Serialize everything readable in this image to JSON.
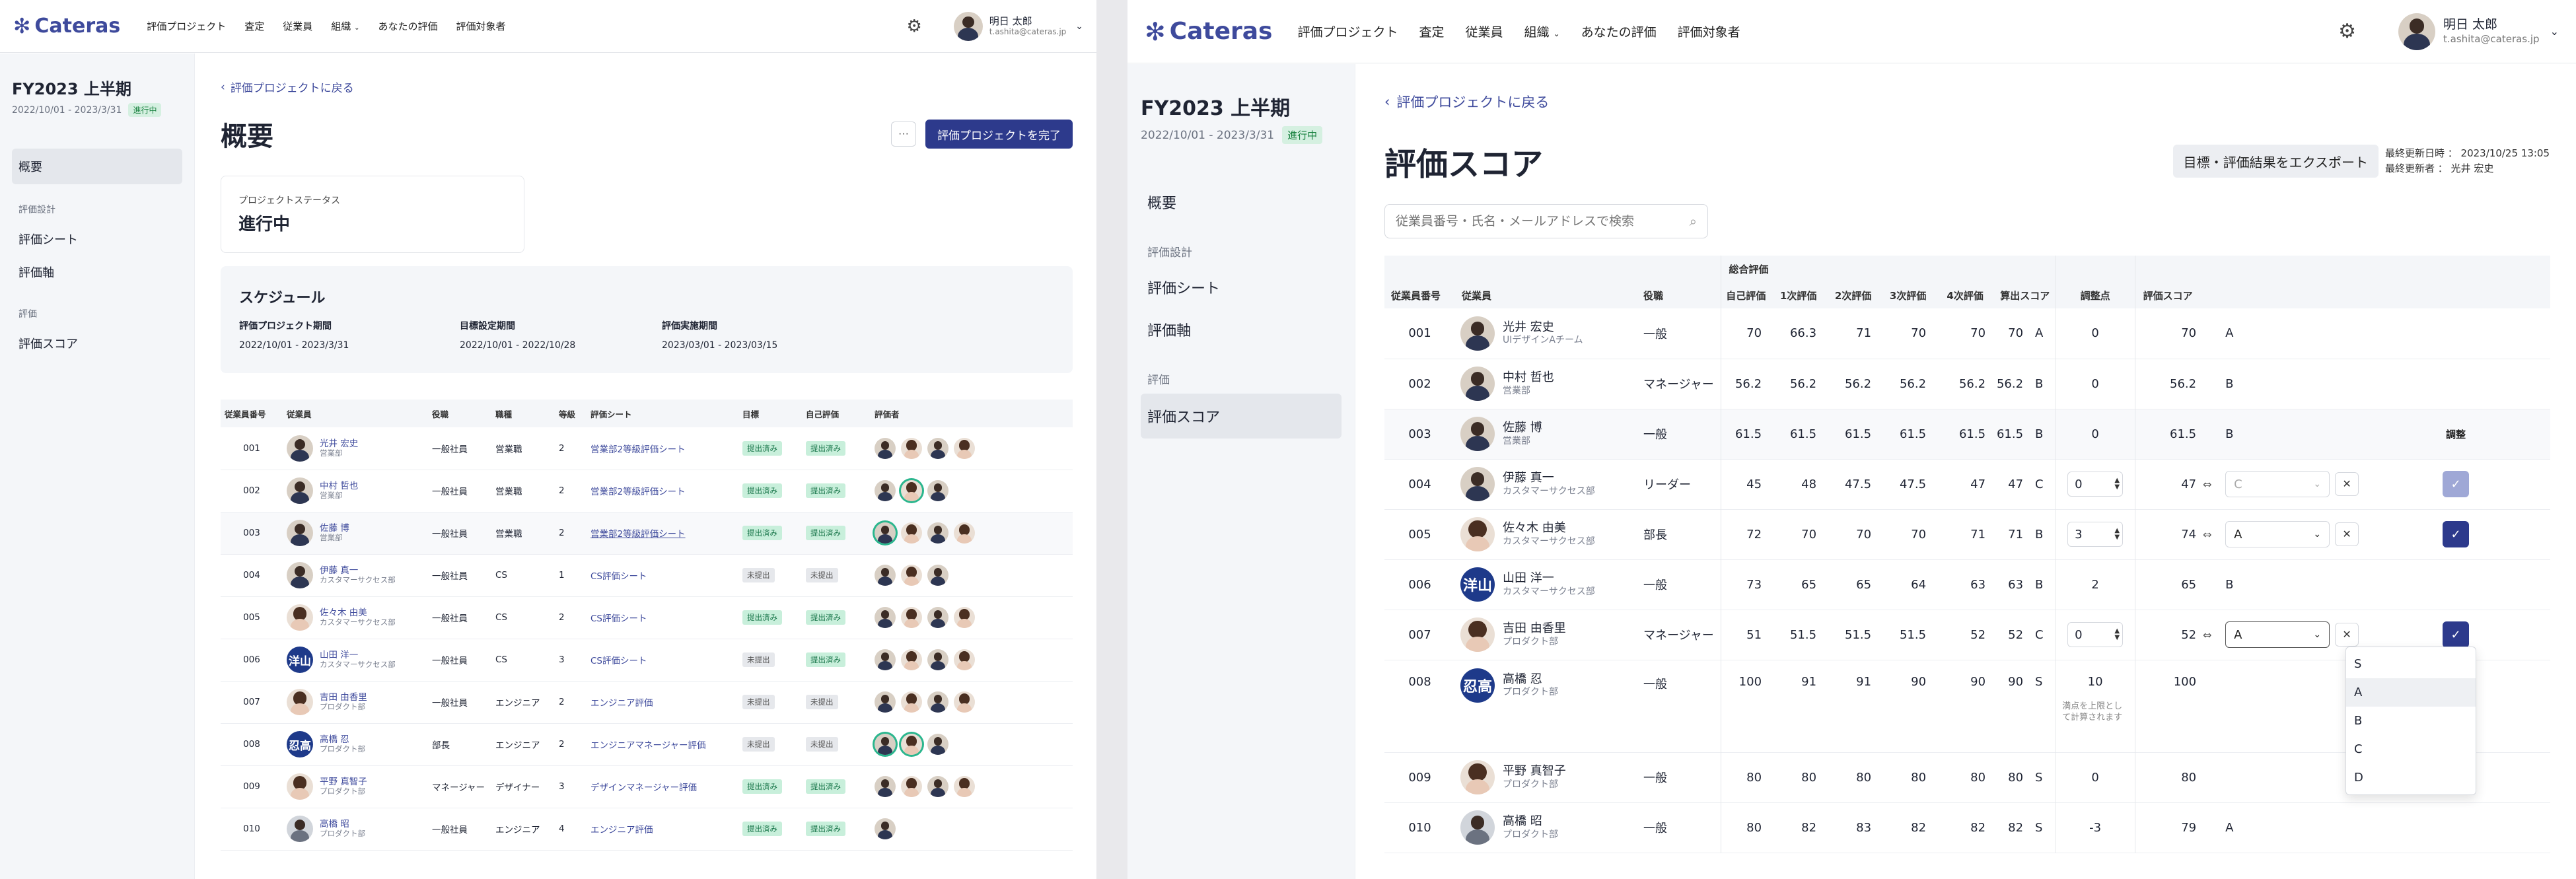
{
  "brand": {
    "name": "Cateras"
  },
  "nav": {
    "items": [
      "評価プロジェクト",
      "査定",
      "従業員",
      "組織",
      "あなたの評価",
      "評価対象者"
    ],
    "org_item": "組織"
  },
  "user": {
    "name": "明日 太郎",
    "email": "t.ashita@cateras.jp"
  },
  "project": {
    "name": "FY2023 上半期",
    "period": "2022/10/01 - 2023/3/31",
    "status": "進行中"
  },
  "sidebar": {
    "overview": "概要",
    "group_design": "評価設計",
    "sheet": "評価シート",
    "axis": "評価軸",
    "group_eval": "評価",
    "score": "評価スコア"
  },
  "back_link": "評価プロジェクトに戻る",
  "screenA": {
    "title": "概要",
    "more_button": "···",
    "complete_button": "評価プロジェクトを完了",
    "status_card": {
      "label": "プロジェクトステータス",
      "value": "進行中"
    },
    "schedule": {
      "title": "スケジュール",
      "items": [
        {
          "label": "評価プロジェクト期間",
          "value": "2022/10/01 - 2023/3/31"
        },
        {
          "label": "目標設定期間",
          "value": "2022/10/01 - 2022/10/28"
        },
        {
          "label": "評価実施期間",
          "value": "2023/03/01 - 2023/03/15"
        }
      ]
    },
    "columns": [
      "従業員番号",
      "従業員",
      "役職",
      "職種",
      "等級",
      "評価シート",
      "目標",
      "自己評価",
      "評価者"
    ],
    "rows": [
      {
        "id": "001",
        "name": "光井 宏史",
        "dept": "営業部",
        "role": "一般社員",
        "job": "営業職",
        "grade": "2",
        "sheet": "営業部2等級評価シート",
        "goal": "提出済み",
        "self": "提出済み",
        "ev": 4,
        "av": "m",
        "ring": []
      },
      {
        "id": "002",
        "name": "中村 哲也",
        "dept": "営業部",
        "role": "一般社員",
        "job": "営業職",
        "grade": "2",
        "sheet": "営業部2等級評価シート",
        "goal": "提出済み",
        "self": "提出済み",
        "ev": 3,
        "av": "m",
        "ring": [
          1
        ]
      },
      {
        "id": "003",
        "name": "佐藤 博",
        "dept": "営業部",
        "role": "一般社員",
        "job": "営業職",
        "grade": "2",
        "sheet": "営業部2等級評価シート",
        "goal": "提出済み",
        "self": "提出済み",
        "ev": 4,
        "av": "m",
        "ring": [
          0
        ]
      },
      {
        "id": "004",
        "name": "伊藤 真一",
        "dept": "カスタマーサクセス部",
        "role": "一般社員",
        "job": "CS",
        "grade": "1",
        "sheet": "CS評価シート",
        "goal": "未提出",
        "self": "未提出",
        "ev": 3,
        "av": "m",
        "ring": []
      },
      {
        "id": "005",
        "name": "佐々木 由美",
        "dept": "カスタマーサクセス部",
        "role": "一般社員",
        "job": "CS",
        "grade": "2",
        "sheet": "CS評価シート",
        "goal": "提出済み",
        "self": "提出済み",
        "ev": 4,
        "av": "f",
        "ring": []
      },
      {
        "id": "006",
        "name": "山田 洋一",
        "dept": "カスタマーサクセス部",
        "role": "一般社員",
        "job": "CS",
        "grade": "3",
        "sheet": "CS評価シート",
        "goal": "未提出",
        "self": "提出済み",
        "ev": 4,
        "av": "k",
        "kanji": "洋山",
        "ring": []
      },
      {
        "id": "007",
        "name": "吉田 由香里",
        "dept": "プロダクト部",
        "role": "一般社員",
        "job": "エンジニア",
        "grade": "2",
        "sheet": "エンジニア評価",
        "goal": "未提出",
        "self": "未提出",
        "ev": 4,
        "av": "f",
        "ring": []
      },
      {
        "id": "008",
        "name": "高橋 忍",
        "dept": "プロダクト部",
        "role": "部長",
        "job": "エンジニア",
        "grade": "2",
        "sheet": "エンジニアマネージャー評価",
        "goal": "未提出",
        "self": "未提出",
        "ev": 3,
        "av": "k",
        "kanji": "忍高",
        "ring": [
          0,
          1
        ]
      },
      {
        "id": "009",
        "name": "平野 真智子",
        "dept": "プロダクト部",
        "role": "マネージャー",
        "job": "デザイナー",
        "grade": "3",
        "sheet": "デザインマネージャー評価",
        "goal": "提出済み",
        "self": "提出済み",
        "ev": 4,
        "av": "f",
        "ring": []
      },
      {
        "id": "010",
        "name": "高橋 昭",
        "dept": "プロダクト部",
        "role": "一般社員",
        "job": "エンジニア",
        "grade": "4",
        "sheet": "エンジニア評価",
        "goal": "提出済み",
        "self": "提出済み",
        "ev": 1,
        "av": "g",
        "ring": []
      }
    ]
  },
  "screenB": {
    "title": "評価スコア",
    "export_button": "目標・評価結果をエクスポート",
    "meta": {
      "updated_label": "最終更新日時",
      "updated_value": "2023/10/25 13:05",
      "updater_label": "最終更新者",
      "updater_value": "光井 宏史"
    },
    "search_placeholder": "従業員番号・氏名・メールアドレスで検索",
    "group_header": "総合評価",
    "columns": {
      "id": "従業員番号",
      "emp": "従業員",
      "role": "役職",
      "self": "自己評価",
      "r1": "1次評価",
      "r2": "2次評価",
      "r3": "3次評価",
      "r4": "4次評価",
      "calc": "算出スコア",
      "adj": "調整点",
      "score": "評価スコア"
    },
    "adjust_button": "調整",
    "hint": "満点を上限として計算されます",
    "dropdown_options": [
      "S",
      "A",
      "B",
      "C",
      "D"
    ],
    "dropdown_selected": "A",
    "rows": [
      {
        "id": "001",
        "name": "光井 宏史",
        "dept": "UIデザインAチーム",
        "role": "一般",
        "self": "70",
        "r1": "66.3",
        "r2": "71",
        "r3": "70",
        "r4": "70",
        "calc": "70",
        "cg": "A",
        "adj": "0",
        "score": "70",
        "grade": "A",
        "mode": "static",
        "av": "m"
      },
      {
        "id": "002",
        "name": "中村 哲也",
        "dept": "営業部",
        "role": "マネージャー",
        "self": "56.2",
        "r1": "56.2",
        "r2": "56.2",
        "r3": "56.2",
        "r4": "56.2",
        "calc": "56.2",
        "cg": "B",
        "adj": "0",
        "score": "56.2",
        "grade": "B",
        "mode": "static",
        "av": "m"
      },
      {
        "id": "003",
        "name": "佐藤 博",
        "dept": "営業部",
        "role": "一般",
        "self": "61.5",
        "r1": "61.5",
        "r2": "61.5",
        "r3": "61.5",
        "r4": "61.5",
        "calc": "61.5",
        "cg": "B",
        "adj": "0",
        "score": "61.5",
        "grade": "B",
        "mode": "hover",
        "av": "m"
      },
      {
        "id": "004",
        "name": "伊藤 真一",
        "dept": "カスタマーサクセス部",
        "role": "リーダー",
        "self": "45",
        "r1": "48",
        "r2": "47.5",
        "r3": "47.5",
        "r4": "47",
        "calc": "47",
        "cg": "C",
        "adj": "0",
        "score": "47",
        "grade": "C",
        "mode": "edit-disabled",
        "av": "m"
      },
      {
        "id": "005",
        "name": "佐々木 由美",
        "dept": "カスタマーサクセス部",
        "role": "部長",
        "self": "72",
        "r1": "70",
        "r2": "70",
        "r3": "70",
        "r4": "71",
        "calc": "71",
        "cg": "B",
        "adj": "3",
        "score": "74",
        "grade": "A",
        "mode": "edit",
        "av": "f"
      },
      {
        "id": "006",
        "name": "山田 洋一",
        "dept": "カスタマーサクセス部",
        "role": "一般",
        "self": "73",
        "r1": "65",
        "r2": "65",
        "r3": "64",
        "r4": "63",
        "calc": "63",
        "cg": "B",
        "adj": "2",
        "score": "65",
        "grade": "B",
        "mode": "static",
        "av": "k",
        "kanji": "洋山"
      },
      {
        "id": "007",
        "name": "吉田 由香里",
        "dept": "プロダクト部",
        "role": "マネージャー",
        "self": "51",
        "r1": "51.5",
        "r2": "51.5",
        "r3": "51.5",
        "r4": "52",
        "calc": "52",
        "cg": "C",
        "adj": "0",
        "score": "52",
        "grade": "A",
        "mode": "edit-open",
        "av": "f"
      },
      {
        "id": "008",
        "name": "高橋 忍",
        "dept": "プロダクト部",
        "role": "一般",
        "self": "100",
        "r1": "91",
        "r2": "91",
        "r3": "90",
        "r4": "90",
        "calc": "90",
        "cg": "S",
        "adj": "10",
        "score": "100",
        "grade": "",
        "mode": "hint",
        "av": "k",
        "kanji": "忍高"
      },
      {
        "id": "009",
        "name": "平野 真智子",
        "dept": "プロダクト部",
        "role": "一般",
        "self": "80",
        "r1": "80",
        "r2": "80",
        "r3": "80",
        "r4": "80",
        "calc": "80",
        "cg": "S",
        "adj": "0",
        "score": "80",
        "grade": "",
        "mode": "static",
        "av": "f"
      },
      {
        "id": "010",
        "name": "高橋 昭",
        "dept": "プロダクト部",
        "role": "一般",
        "self": "80",
        "r1": "82",
        "r2": "83",
        "r3": "82",
        "r4": "82",
        "calc": "82",
        "cg": "S",
        "adj": "-3",
        "score": "79",
        "grade": "A",
        "mode": "static",
        "av": "g"
      }
    ]
  },
  "colors": {
    "primary": "#2d3a8c",
    "link": "#3e4a9c",
    "badge_bg": "#d5f0e1",
    "badge_fg": "#16803d",
    "sidebar_bg": "#f4f6f9"
  }
}
